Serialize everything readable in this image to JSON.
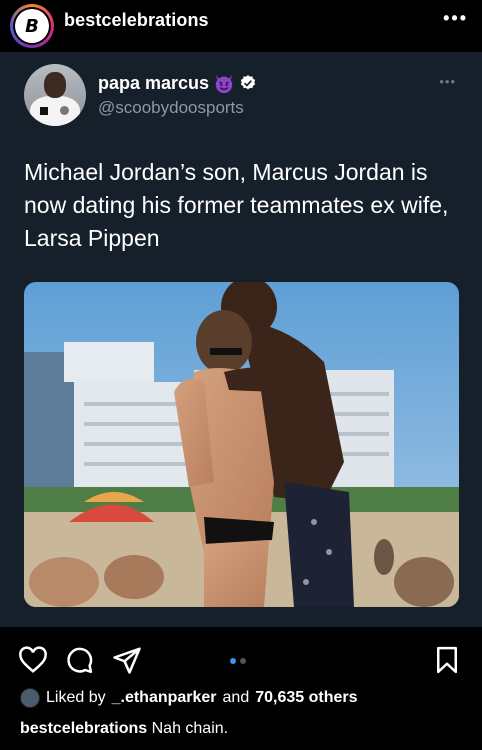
{
  "header": {
    "account_avatar_letter": "B",
    "username": "bestcelebrations",
    "more": "•••"
  },
  "tweet": {
    "display_name": "papa marcus",
    "name_emoji": "smiling-devil-icon",
    "verified": "verified-badge-icon",
    "handle": "@scoobydoosports",
    "more": "•••",
    "text": "Michael Jordan’s son, Marcus Jordan is now dating his former teammates ex wife, Larsa Pippen",
    "colors": {
      "background": "#15202b",
      "handle": "#8b98a5",
      "verified": "#1d9bf0"
    }
  },
  "actions": {
    "icons": [
      "heart-icon",
      "comment-icon",
      "share-icon",
      "bookmark-icon"
    ],
    "carousel": {
      "count": 2,
      "active": 1,
      "active_color": "#3897f0"
    }
  },
  "likes": {
    "prefix": "Liked by",
    "user": "_.ethanparker",
    "middle": "and",
    "others": "70,635 others"
  },
  "caption": {
    "user": "bestcelebrations",
    "text": "Nah chain."
  }
}
